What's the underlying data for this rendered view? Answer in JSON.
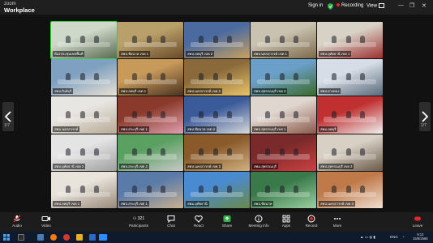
{
  "app": {
    "brand_top": "zoom",
    "brand_bottom": "Workplace"
  },
  "topbar": {
    "sign_in": "Sign in",
    "recording": "Recording",
    "view": "View"
  },
  "tiles": [
    {
      "label": "ห้องประชุมเขตพื้นที่",
      "colors": [
        "#cfd9c9",
        "#5a6b52"
      ],
      "active": true
    },
    {
      "label": "สพป.ชัยนาท เขต 1",
      "colors": [
        "#b9a06a",
        "#6a4a2a"
      ]
    },
    {
      "label": "สพป.ลพบุรี เขต 2",
      "colors": [
        "#4a6aa0",
        "#c8a060"
      ]
    },
    {
      "label": "สพป.นครสวรรค์ เขต 1",
      "colors": [
        "#c9c2b0",
        "#7d6a4b"
      ]
    },
    {
      "label": "สพป.อุทัยธานี เขต 1",
      "colors": [
        "#d8d2c6",
        "#9c2f2f"
      ]
    },
    {
      "label": "สพป.สิงห์บุรี",
      "colors": [
        "#7fa0c0",
        "#e9e1d4"
      ]
    },
    {
      "label": "สพป.ลพบุรี เขต 1",
      "colors": [
        "#c79a5a",
        "#4b3320"
      ]
    },
    {
      "label": "สพป.นครสวรรค์ เขต 2",
      "colors": [
        "#8a6a3a",
        "#e9c46a"
      ]
    },
    {
      "label": "สพป.สุพรรณบุรี เขต 3",
      "colors": [
        "#6aa0c8",
        "#3a6a2a"
      ]
    },
    {
      "label": "สพป.อ่างทอง",
      "colors": [
        "#d6dde6",
        "#5a6a7a"
      ]
    },
    {
      "label": "สพม.นครสวรรค์",
      "colors": [
        "#e8e6e2",
        "#b8aa96"
      ]
    },
    {
      "label": "สพป.สระบุรี เขต 1",
      "colors": [
        "#8a3a2a",
        "#e0a0b0"
      ]
    },
    {
      "label": "สพป.ชัยนาท เขต 2",
      "colors": [
        "#3a5a9a",
        "#d8d8d8"
      ]
    },
    {
      "label": "สพป.สุพรรณบุรี เขต 1",
      "colors": [
        "#e0d6d0",
        "#8a5a4a"
      ]
    },
    {
      "label": "สพม.ลพบุรี",
      "colors": [
        "#c03030",
        "#f0f0f0"
      ]
    },
    {
      "label": "สพป.อุทัยธานี เขต 2",
      "colors": [
        "#e4e4e4",
        "#a0a0a0"
      ]
    },
    {
      "label": "สพป.สระบุรี เขต 2",
      "colors": [
        "#5aa060",
        "#c8c8c8"
      ]
    },
    {
      "label": "สพป.นครสวรรค์ เขต 3",
      "colors": [
        "#8a5a2a",
        "#d0b080"
      ]
    },
    {
      "label": "สพม.สุพรรณบุรี",
      "colors": [
        "#7a2a2a",
        "#d04040"
      ]
    },
    {
      "label": "สพป.สุพรรณบุรี เขต 2",
      "colors": [
        "#d8d0c4",
        "#6a5a4a"
      ]
    },
    {
      "label": "สพป.ลพบุรี เขต 1",
      "colors": [
        "#e8e4dc",
        "#9a8a7a"
      ]
    },
    {
      "label": "สพป.สระบุรี เขต 1",
      "colors": [
        "#5a7aa8",
        "#c8b090"
      ]
    },
    {
      "label": "สพม.อุทัยธานี",
      "colors": [
        "#4a8ad0",
        "#6a8a4a"
      ]
    },
    {
      "label": "สพป.ชัยนาท",
      "colors": [
        "#3a7a4a",
        "#9ad0a0"
      ]
    },
    {
      "label": "สพป.นครสวรรค์ เขต 3",
      "colors": [
        "#c07a4a",
        "#f0e0d0"
      ]
    }
  ],
  "paging": {
    "left": "1/7",
    "right": "1/7"
  },
  "toolbar": {
    "audio": "Audio",
    "video": "Video",
    "participants": "Participants",
    "participants_count": "321",
    "chat": "Chat",
    "react": "React",
    "share": "Share",
    "meeting_info": "Meeting info",
    "apps": "Apps",
    "record": "Record",
    "more": "More",
    "leave": "Leave"
  },
  "taskbar": {
    "lang": "ENG",
    "time": "9:13",
    "date": "15/8/2566"
  }
}
